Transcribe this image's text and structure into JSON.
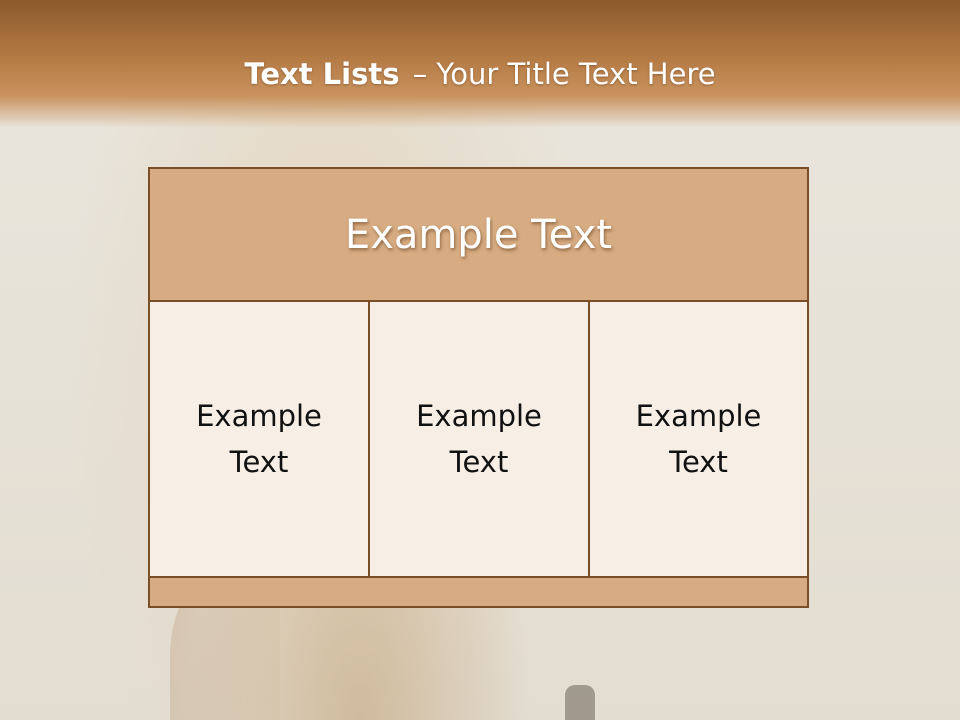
{
  "slide": {
    "title_bold": "Text Lists",
    "title_rest": "– Your Title Text Here"
  },
  "diagram": {
    "header": "Example Text",
    "cells": [
      {
        "line1": "Example",
        "line2": "Text"
      },
      {
        "line1": "Example",
        "line2": "Text"
      },
      {
        "line1": "Example",
        "line2": "Text"
      }
    ]
  },
  "colors": {
    "banner": "#b47a44",
    "header_fill": "#d7ac82",
    "cell_fill": "#f7eee5",
    "border": "#7a4e27"
  }
}
